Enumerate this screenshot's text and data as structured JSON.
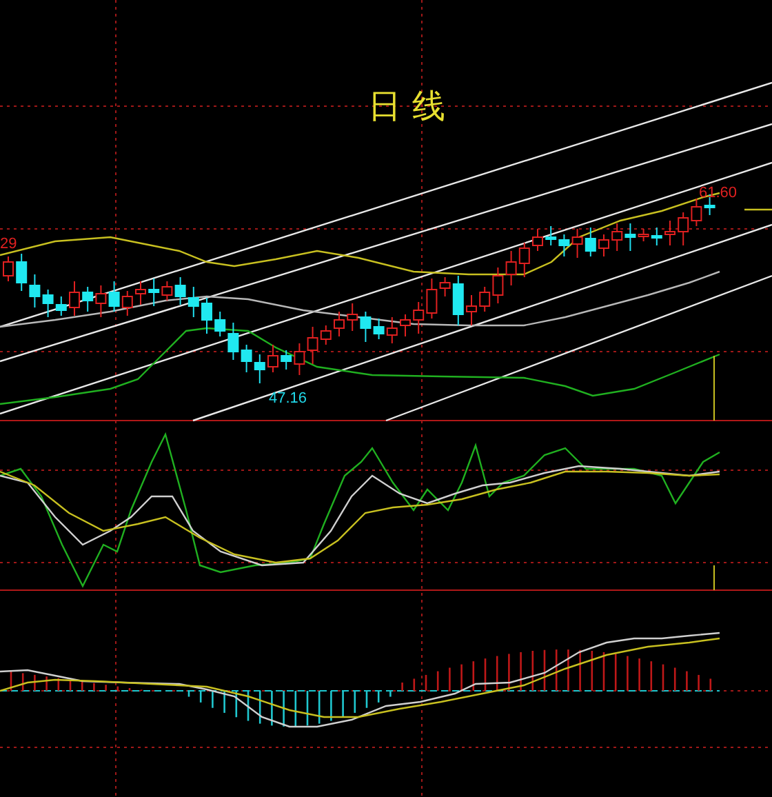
{
  "title": "日 线",
  "price_labels": [
    {
      "kind": "edge",
      "text": "29"
    },
    {
      "kind": "high",
      "text": "61.60"
    },
    {
      "kind": "low",
      "text": "47.16"
    }
  ]
}
